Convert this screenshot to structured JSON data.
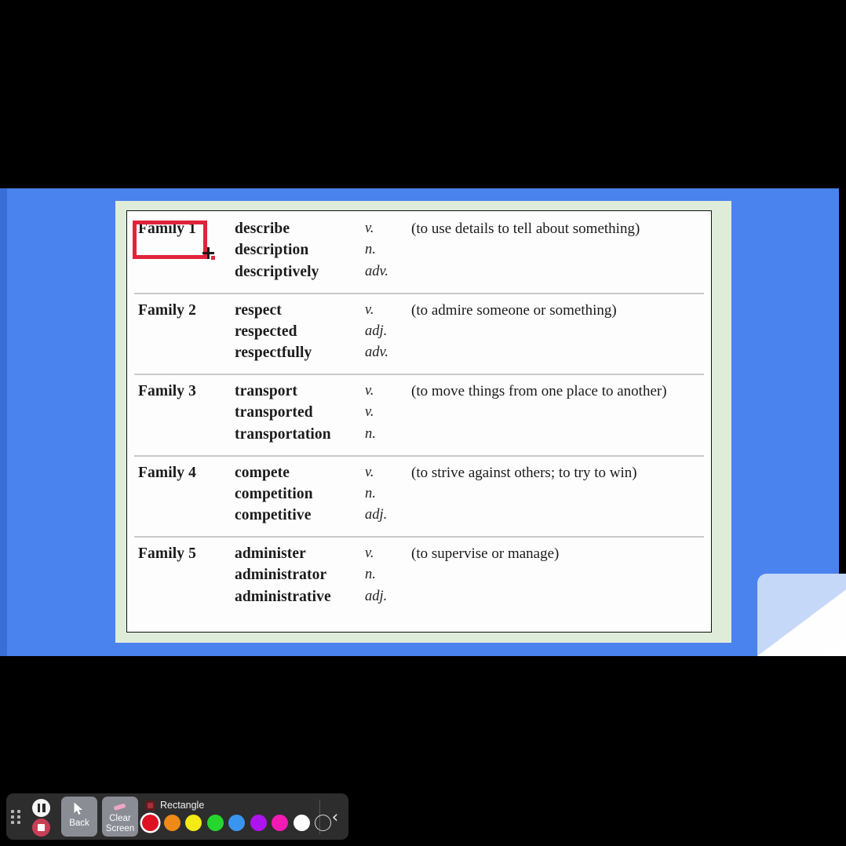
{
  "slide": {
    "background_color": "#4a82ee",
    "card_color": "#dfecda",
    "table_background": "#fdfdfd",
    "families": [
      {
        "label": "Family 1",
        "definition": "(to use details to tell about something)",
        "entries": [
          {
            "word": "describe",
            "pos": "v."
          },
          {
            "word": "description",
            "pos": "n."
          },
          {
            "word": "descriptively",
            "pos": "adv."
          }
        ]
      },
      {
        "label": "Family 2",
        "definition": "(to admire someone or something)",
        "entries": [
          {
            "word": "respect",
            "pos": "v."
          },
          {
            "word": "respected",
            "pos": "adj."
          },
          {
            "word": "respectfully",
            "pos": "adv."
          }
        ]
      },
      {
        "label": "Family 3",
        "definition": "(to move things from one place to another)",
        "entries": [
          {
            "word": "transport",
            "pos": "v."
          },
          {
            "word": "transported",
            "pos": "v."
          },
          {
            "word": "transportation",
            "pos": "n."
          }
        ]
      },
      {
        "label": "Family 4",
        "definition": "(to strive against others; to try to win)",
        "entries": [
          {
            "word": "compete",
            "pos": "v."
          },
          {
            "word": "competition",
            "pos": "n."
          },
          {
            "word": "competitive",
            "pos": "adj."
          }
        ]
      },
      {
        "label": "Family 5",
        "definition": "(to supervise or manage)",
        "entries": [
          {
            "word": "administer",
            "pos": "v."
          },
          {
            "word": "administrator",
            "pos": "n."
          },
          {
            "word": "administrative",
            "pos": "adj."
          }
        ]
      }
    ]
  },
  "annotation": {
    "shape": "rectangle",
    "stroke_color": "#e0243a",
    "target_text": "Family 1"
  },
  "toolbar": {
    "back_label": "Back",
    "clear_screen_label": "Clear\nScreen",
    "clear_screen_line1": "Clear",
    "clear_screen_line2": "Screen",
    "tool_name": "Rectangle",
    "collapse_glyph": "‹",
    "selected_color": "#dd1122",
    "colors": [
      {
        "name": "red",
        "hex": "#dd1122",
        "selected": true
      },
      {
        "name": "orange",
        "hex": "#ef8a17",
        "selected": false
      },
      {
        "name": "yellow",
        "hex": "#f3ea16",
        "selected": false
      },
      {
        "name": "green",
        "hex": "#26d62e",
        "selected": false
      },
      {
        "name": "blue",
        "hex": "#3a95f0",
        "selected": false
      },
      {
        "name": "purple",
        "hex": "#ad14ef",
        "selected": false
      },
      {
        "name": "magenta",
        "hex": "#f31bb3",
        "selected": false
      },
      {
        "name": "white",
        "hex": "#ffffff",
        "selected": false
      },
      {
        "name": "transparent",
        "hex": "transparent",
        "selected": false
      }
    ]
  }
}
